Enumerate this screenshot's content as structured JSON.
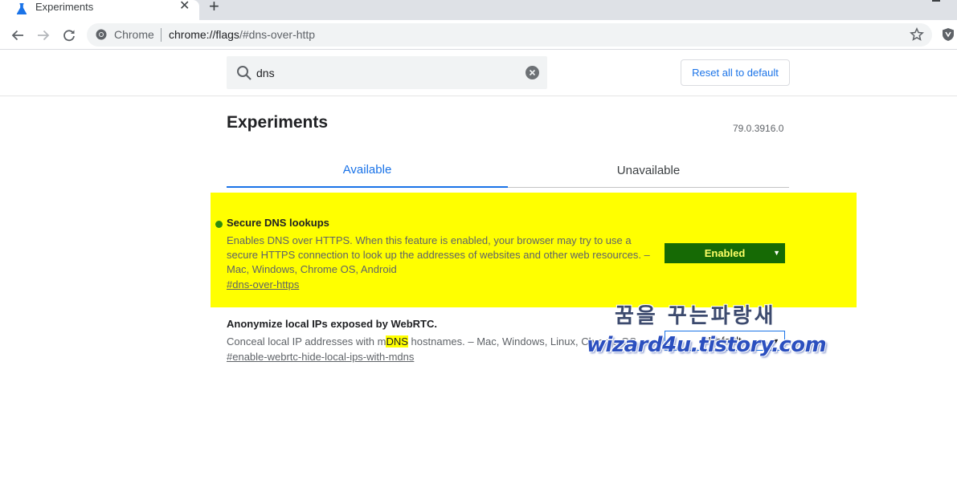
{
  "browser": {
    "tab_title": "Experiments",
    "tab_close": "✕",
    "new_tab": "+",
    "omnibox_scheme_label": "Chrome",
    "url_host": "chrome://flags",
    "url_path": "/#dns-over-http"
  },
  "header": {
    "search_value": "dns",
    "reset_label": "Reset all to default"
  },
  "page": {
    "title": "Experiments",
    "version": "79.0.3916.0",
    "tabs": [
      {
        "label": "Available",
        "active": true
      },
      {
        "label": "Unavailable",
        "active": false
      }
    ]
  },
  "experiments": [
    {
      "name": "Secure DNS lookups",
      "description": "Enables DNS over HTTPS. When this feature is enabled, your browser may try to use a secure HTTPS connection to look up the addresses of websites and other web resources. – Mac, Windows, Chrome OS, Android",
      "link": "#dns-over-https",
      "selected": "Enabled",
      "highlighted": true
    },
    {
      "name": "Anonymize local IPs exposed by WebRTC.",
      "description_before": "Conceal local IP addresses with m",
      "description_highlight": "DNS",
      "description_after": " hostnames. – Mac, Windows, Linux, Chrome OS",
      "link": "#enable-webrtc-hide-local-ips-with-mdns",
      "selected": "Default",
      "highlighted": false
    }
  ],
  "watermark": {
    "top": "꿈을 꾸는파랑새",
    "bottom": "wizard4u.tistory.com"
  },
  "colors": {
    "accent": "#1a73e8",
    "highlight": "#ffff00",
    "enabled_bg": "#166a05",
    "enabled_text": "#ffff66"
  }
}
